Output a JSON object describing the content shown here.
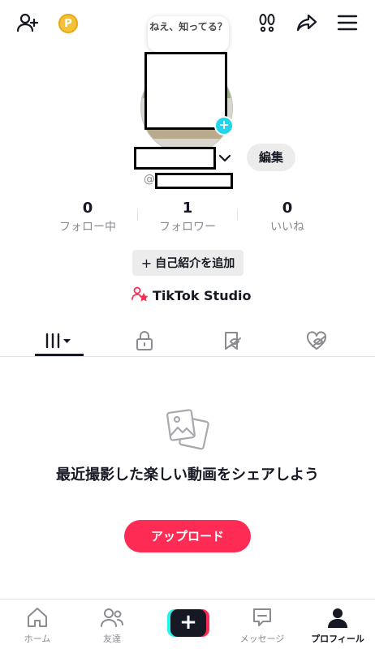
{
  "header": {
    "icons": [
      "add-friend-icon",
      "coin-icon",
      "footprints-icon",
      "share-icon",
      "menu-icon"
    ],
    "coin_letter": "P",
    "note_bubble": "ねえ、知ってる？"
  },
  "profile": {
    "at_symbol": "@",
    "edit_label": "編集",
    "stats": [
      {
        "value": "0",
        "label": "フォロー中"
      },
      {
        "value": "1",
        "label": "フォロワー"
      },
      {
        "value": "0",
        "label": "いいね"
      }
    ],
    "add_bio_label": "自己紹介を追加",
    "add_bio_prefix": "+",
    "studio_label": "TikTok Studio"
  },
  "tabs": [
    "videos-tab-icon",
    "private-lock-icon",
    "favorites-icon",
    "liked-icon"
  ],
  "empty_state": {
    "title": "最近撮影した楽しい動画をシェアしよう",
    "upload_label": "アップロード"
  },
  "bottom_nav": [
    {
      "label": "ホーム",
      "icon": "home-icon"
    },
    {
      "label": "友達",
      "icon": "friends-icon"
    },
    {
      "label": "",
      "icon": "create-plus-icon"
    },
    {
      "label": "メッセージ",
      "icon": "message-icon"
    },
    {
      "label": "プロフィール",
      "icon": "profile-icon"
    }
  ],
  "colors": {
    "accent": "#fe2c55",
    "cyan": "#25f4ee",
    "text": "#161823",
    "muted": "#8a8b91"
  }
}
